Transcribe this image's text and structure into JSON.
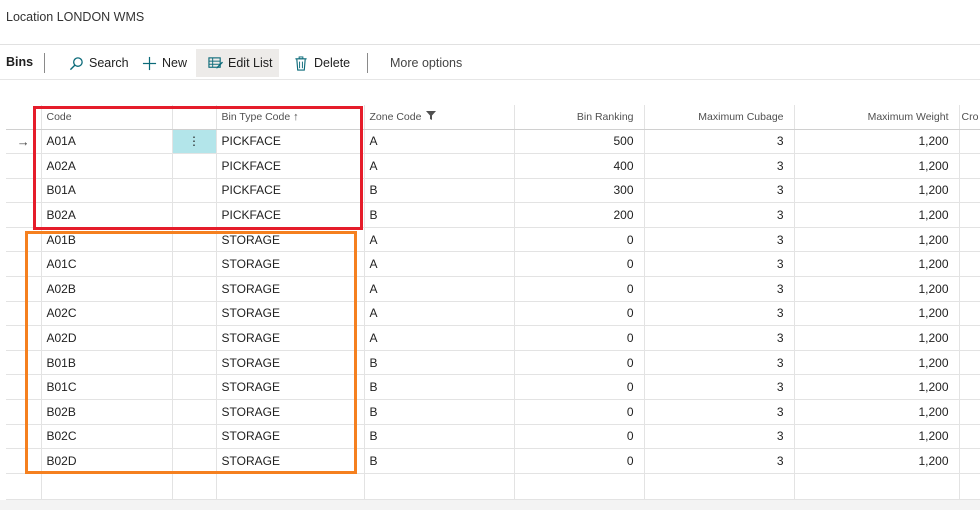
{
  "page": {
    "location_title": "Location LONDON WMS"
  },
  "toolbar": {
    "title": "Bins",
    "search_label": "Search",
    "new_label": "New",
    "edit_list_label": "Edit List",
    "delete_label": "Delete",
    "more_options_label": "More options"
  },
  "table": {
    "columns": {
      "code": "Code",
      "bin_type_code": "Bin Type Code",
      "bin_type_sort_indicator": "↑",
      "zone_code": "Zone Code",
      "bin_ranking": "Bin Ranking",
      "maximum_cubage": "Maximum Cubage",
      "maximum_weight": "Maximum Weight",
      "cross_dock_partial": "Cro"
    },
    "current_row_indicator": "→",
    "row_menu_glyph": "⋮",
    "rows": [
      {
        "code": "A01A",
        "bin_type": "PICKFACE",
        "zone": "A",
        "ranking": "500",
        "cubage": "3",
        "weight": "1,200"
      },
      {
        "code": "A02A",
        "bin_type": "PICKFACE",
        "zone": "A",
        "ranking": "400",
        "cubage": "3",
        "weight": "1,200"
      },
      {
        "code": "B01A",
        "bin_type": "PICKFACE",
        "zone": "B",
        "ranking": "300",
        "cubage": "3",
        "weight": "1,200"
      },
      {
        "code": "B02A",
        "bin_type": "PICKFACE",
        "zone": "B",
        "ranking": "200",
        "cubage": "3",
        "weight": "1,200"
      },
      {
        "code": "A01B",
        "bin_type": "STORAGE",
        "zone": "A",
        "ranking": "0",
        "cubage": "3",
        "weight": "1,200"
      },
      {
        "code": "A01C",
        "bin_type": "STORAGE",
        "zone": "A",
        "ranking": "0",
        "cubage": "3",
        "weight": "1,200"
      },
      {
        "code": "A02B",
        "bin_type": "STORAGE",
        "zone": "A",
        "ranking": "0",
        "cubage": "3",
        "weight": "1,200"
      },
      {
        "code": "A02C",
        "bin_type": "STORAGE",
        "zone": "A",
        "ranking": "0",
        "cubage": "3",
        "weight": "1,200"
      },
      {
        "code": "A02D",
        "bin_type": "STORAGE",
        "zone": "A",
        "ranking": "0",
        "cubage": "3",
        "weight": "1,200"
      },
      {
        "code": "B01B",
        "bin_type": "STORAGE",
        "zone": "B",
        "ranking": "0",
        "cubage": "3",
        "weight": "1,200"
      },
      {
        "code": "B01C",
        "bin_type": "STORAGE",
        "zone": "B",
        "ranking": "0",
        "cubage": "3",
        "weight": "1,200"
      },
      {
        "code": "B02B",
        "bin_type": "STORAGE",
        "zone": "B",
        "ranking": "0",
        "cubage": "3",
        "weight": "1,200"
      },
      {
        "code": "B02C",
        "bin_type": "STORAGE",
        "zone": "B",
        "ranking": "0",
        "cubage": "3",
        "weight": "1,200"
      },
      {
        "code": "B02D",
        "bin_type": "STORAGE",
        "zone": "B",
        "ranking": "0",
        "cubage": "3",
        "weight": "1,200"
      }
    ]
  },
  "annotations": {
    "pickface_box_color": "#e51c2a",
    "storage_box_color": "#f5801f"
  },
  "icons": {
    "search": "search-icon",
    "new": "plus-icon",
    "edit_list": "edit-list-icon",
    "delete": "trash-icon",
    "filter": "filter-icon"
  }
}
